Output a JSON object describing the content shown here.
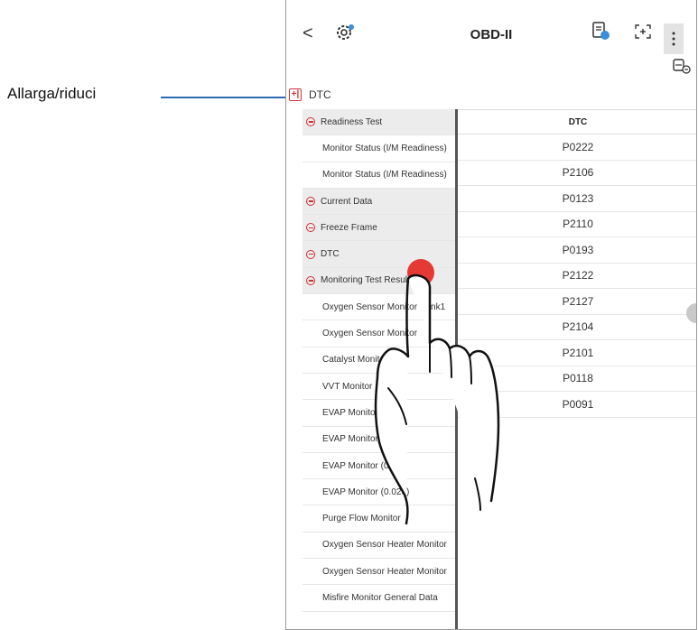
{
  "annotation": {
    "label": "Allarga/riduci"
  },
  "topbar": {
    "title": "OBD-II",
    "back_glyph": "<",
    "icons": [
      "back-icon",
      "gear-icon",
      "report-icon",
      "expand-icon",
      "more-icon",
      "car-icon"
    ]
  },
  "section": {
    "toggle_glyph": "+|",
    "label": "DTC"
  },
  "tree": {
    "rows": [
      {
        "type": "group",
        "label": "Readiness Test"
      },
      {
        "type": "leaf",
        "label": "Monitor Status (I/M Readiness)"
      },
      {
        "type": "leaf",
        "label": "Monitor Status (I/M Readiness)"
      },
      {
        "type": "group",
        "label": "Current Data"
      },
      {
        "type": "group",
        "label": "Freeze Frame"
      },
      {
        "type": "group",
        "label": "DTC"
      },
      {
        "type": "group",
        "label": "Monitoring Test Results"
      },
      {
        "type": "leaf",
        "label": "Oxygen Sensor Monitor Bank1"
      },
      {
        "type": "leaf",
        "label": "Oxygen Sensor Monitor"
      },
      {
        "type": "leaf",
        "label": "Catalyst Monitor"
      },
      {
        "type": "leaf",
        "label": "VVT Monitor"
      },
      {
        "type": "leaf",
        "label": "EVAP Monitor ("
      },
      {
        "type": "leaf",
        "label": "EVAP Monitor (0.0"
      },
      {
        "type": "leaf",
        "label": "EVAP Monitor (0.040"
      },
      {
        "type": "leaf",
        "label": "EVAP Monitor (0.020)"
      },
      {
        "type": "leaf",
        "label": "Purge Flow Monitor"
      },
      {
        "type": "leaf",
        "label": "Oxygen Sensor Heater Monitor"
      },
      {
        "type": "leaf",
        "label": "Oxygen Sensor Heater Monitor"
      },
      {
        "type": "leaf",
        "label": "Misfire Monitor General Data"
      }
    ]
  },
  "dtc_table": {
    "header": "DTC",
    "codes": [
      "P0222",
      "P2106",
      "P0123",
      "P2110",
      "P0193",
      "P2122",
      "P2127",
      "P2104",
      "P2101",
      "P0118",
      "P0091"
    ]
  },
  "colors": {
    "accent_red": "#d32f2f",
    "callout_blue": "#2b6cb0",
    "group_bg": "#ececec"
  }
}
